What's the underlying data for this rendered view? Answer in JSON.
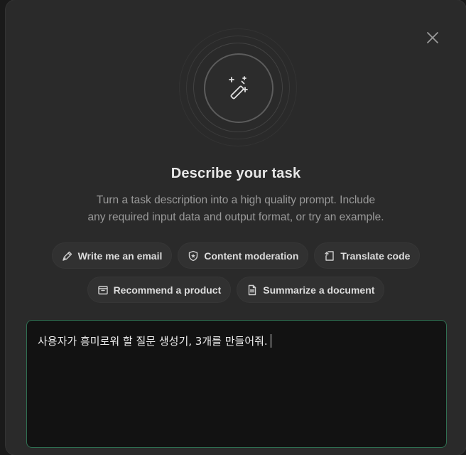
{
  "dialog": {
    "title": "Describe your task",
    "subtitle_line1": "Turn a task description into a high quality prompt. Include",
    "subtitle_line2": "any required input data and output format, or try an example.",
    "close_icon": "close-icon",
    "hero_icon": "magic-wand-sparkle-icon"
  },
  "examples": {
    "row1": [
      {
        "label": "Write me an email",
        "icon": "pen-icon"
      },
      {
        "label": "Content moderation",
        "icon": "shield-star-icon"
      },
      {
        "label": "Translate code",
        "icon": "code-file-icon"
      }
    ],
    "row2": [
      {
        "label": "Recommend a product",
        "icon": "archive-box-icon"
      },
      {
        "label": "Summarize a document",
        "icon": "document-icon"
      }
    ]
  },
  "task_input": {
    "value": "사용자가 흥미로워 할 질문 생성기, 3개를 만들어줘."
  },
  "colors": {
    "background": "#2a2a2a",
    "input_border": "#2f6f52",
    "input_background": "#121212"
  }
}
